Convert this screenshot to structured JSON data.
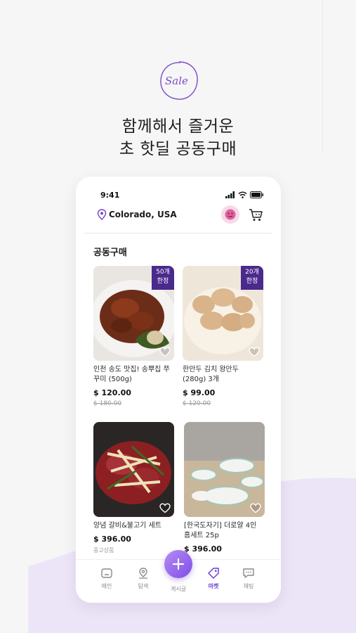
{
  "badge": {
    "text": "Sale"
  },
  "headline": {
    "line1": "함께해서 즐거운",
    "line2": "초 핫딜 공동구매"
  },
  "status": {
    "time": "9:41"
  },
  "location": {
    "label": "Colorado, USA"
  },
  "section": {
    "title": "공동구매"
  },
  "products": [
    {
      "name": "인천 송도 맛집! 송뿌집 쭈꾸미 (500g)",
      "price": "$ 120.00",
      "orig": "$ 180.00",
      "badge_l1": "50개",
      "badge_l2": "한정"
    },
    {
      "name": "한만두 김치 왕만두 (280g) 3개",
      "price": "$ 99.00",
      "orig": "$ 120.00",
      "badge_l1": "20개",
      "badge_l2": "한정"
    },
    {
      "name": "양념 갈비&불고기 세트",
      "price": "$ 396.00",
      "sub": "중고상품"
    },
    {
      "name": "[한국도자기] 더로얄 4인 홈세트 25p",
      "price": "$ 396.00"
    }
  ],
  "nav": {
    "home": "메인",
    "search": "탐색",
    "write": "게시글",
    "market": "마켓",
    "chat": "채팅"
  },
  "colors": {
    "accent": "#6b3fd6",
    "badge": "#4a2a8c",
    "blob": "#ece5f8"
  }
}
